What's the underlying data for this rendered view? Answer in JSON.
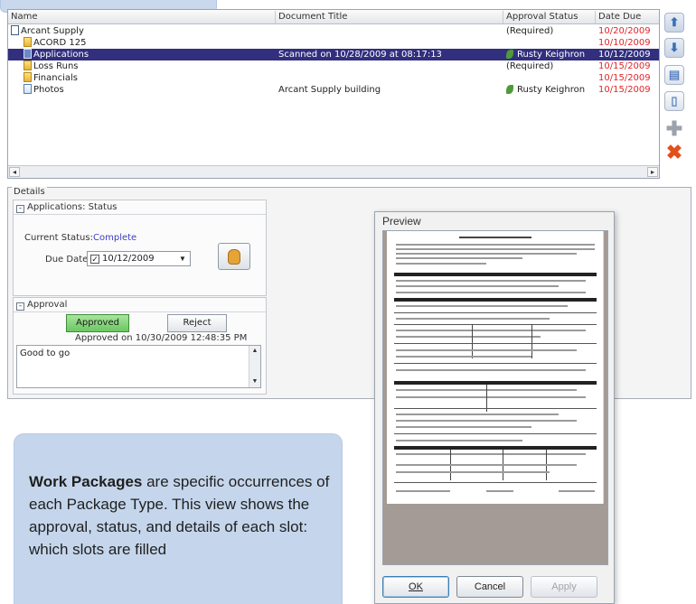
{
  "list": {
    "columns": [
      "Name",
      "Document Title",
      "Approval Status",
      "Date Due"
    ],
    "rows": [
      {
        "name": "Arcant Supply",
        "icon": "package-icon",
        "title": "",
        "status": "(Required)",
        "date": "10/20/2009"
      },
      {
        "name": "ACORD 125",
        "icon": "folder-icon",
        "title": "",
        "status": "",
        "date": "10/10/2009"
      },
      {
        "name": "Applications",
        "icon": "document-icon",
        "title": "Scanned on 10/28/2009 at 08:17:13",
        "status": "Rusty Keighron",
        "date": "10/12/2009",
        "selected": true
      },
      {
        "name": "Loss Runs",
        "icon": "folder-icon",
        "title": "",
        "status": "(Required)",
        "date": "10/15/2009"
      },
      {
        "name": "Financials",
        "icon": "folder-icon",
        "title": "",
        "status": "",
        "date": "10/15/2009"
      },
      {
        "name": "Photos",
        "icon": "document-icon",
        "title": "Arcant Supply building",
        "status": "Rusty Keighron",
        "date": "10/15/2009"
      }
    ]
  },
  "toolbar": {
    "icons": [
      "move-up-icon",
      "move-down-icon",
      "page-view-icon",
      "page-icon",
      "add-icon",
      "delete-icon"
    ],
    "colors": {
      "accent": "#3b6fb8",
      "delete": "#e3501c",
      "selection": "#312f7e",
      "due_date": "#e0262a"
    }
  },
  "details": {
    "legend": "Details",
    "status_group": {
      "title": "Applications: Status",
      "current_status_label": "Current Status:",
      "current_status_value": "Complete",
      "due_date_label": "Due Date:",
      "due_date_value": "10/12/2009"
    },
    "approval_group": {
      "title": "Approval",
      "approved_label": "Approved",
      "reject_label": "Reject",
      "approved_on": "Approved on 10/30/2009 12:48:35 PM",
      "note": "Good to go"
    }
  },
  "preview": {
    "title": "Preview",
    "ok": "OK",
    "cancel": "Cancel",
    "apply": "Apply"
  },
  "callout": {
    "bold": "Work Packages",
    "text": " are specific occurrences of each Package Type.  This view shows the approval, status, and details of each slot: which slots are filled"
  }
}
